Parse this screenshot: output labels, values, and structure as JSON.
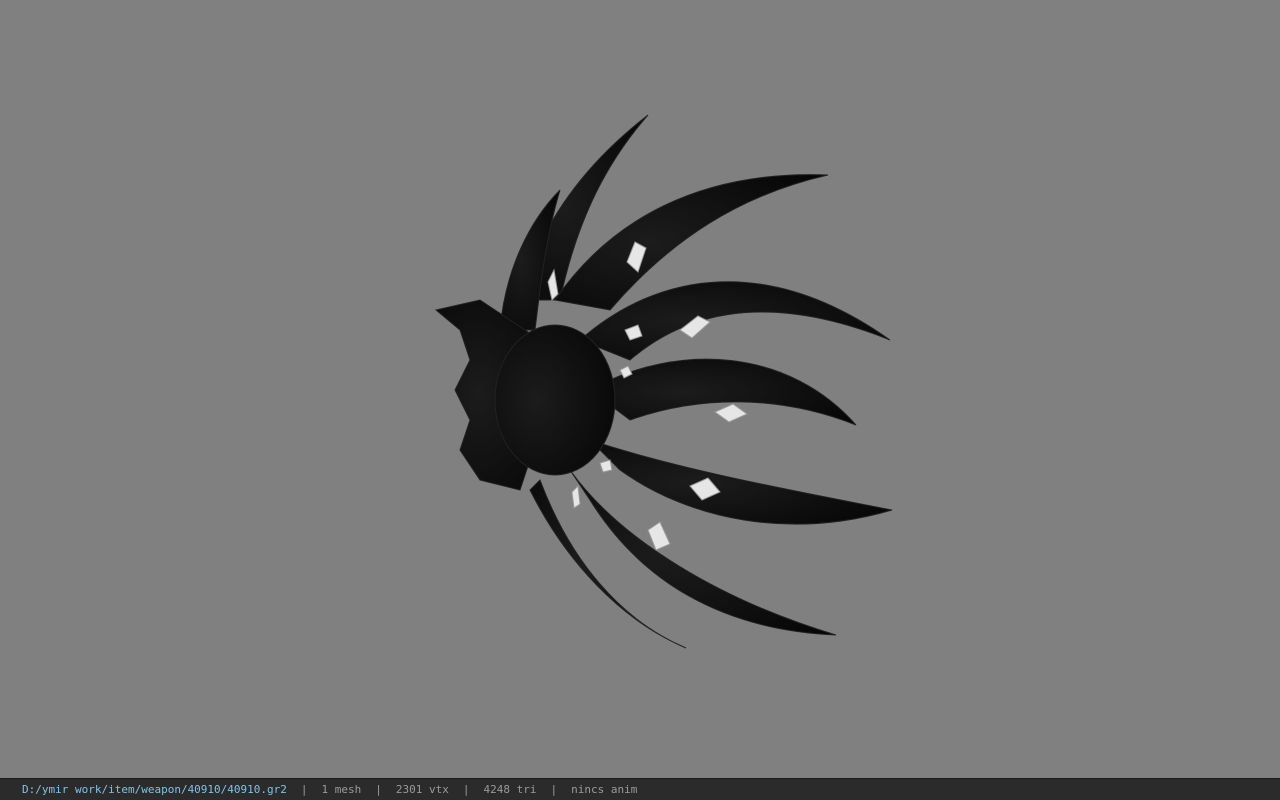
{
  "viewport": {
    "background": "#808080",
    "model_color": "#0f0f0f",
    "gem_color": "#e6e6e6"
  },
  "status_bar": {
    "file_path": "D:/ymir work/item/weapon/40910/40910.gr2",
    "separator": "|",
    "mesh_count": "1 mesh",
    "vertex_count": "2301 vtx",
    "triangle_count": "4248 tri",
    "anim_status": "nincs anim",
    "path_color": "#7ec3e6"
  }
}
